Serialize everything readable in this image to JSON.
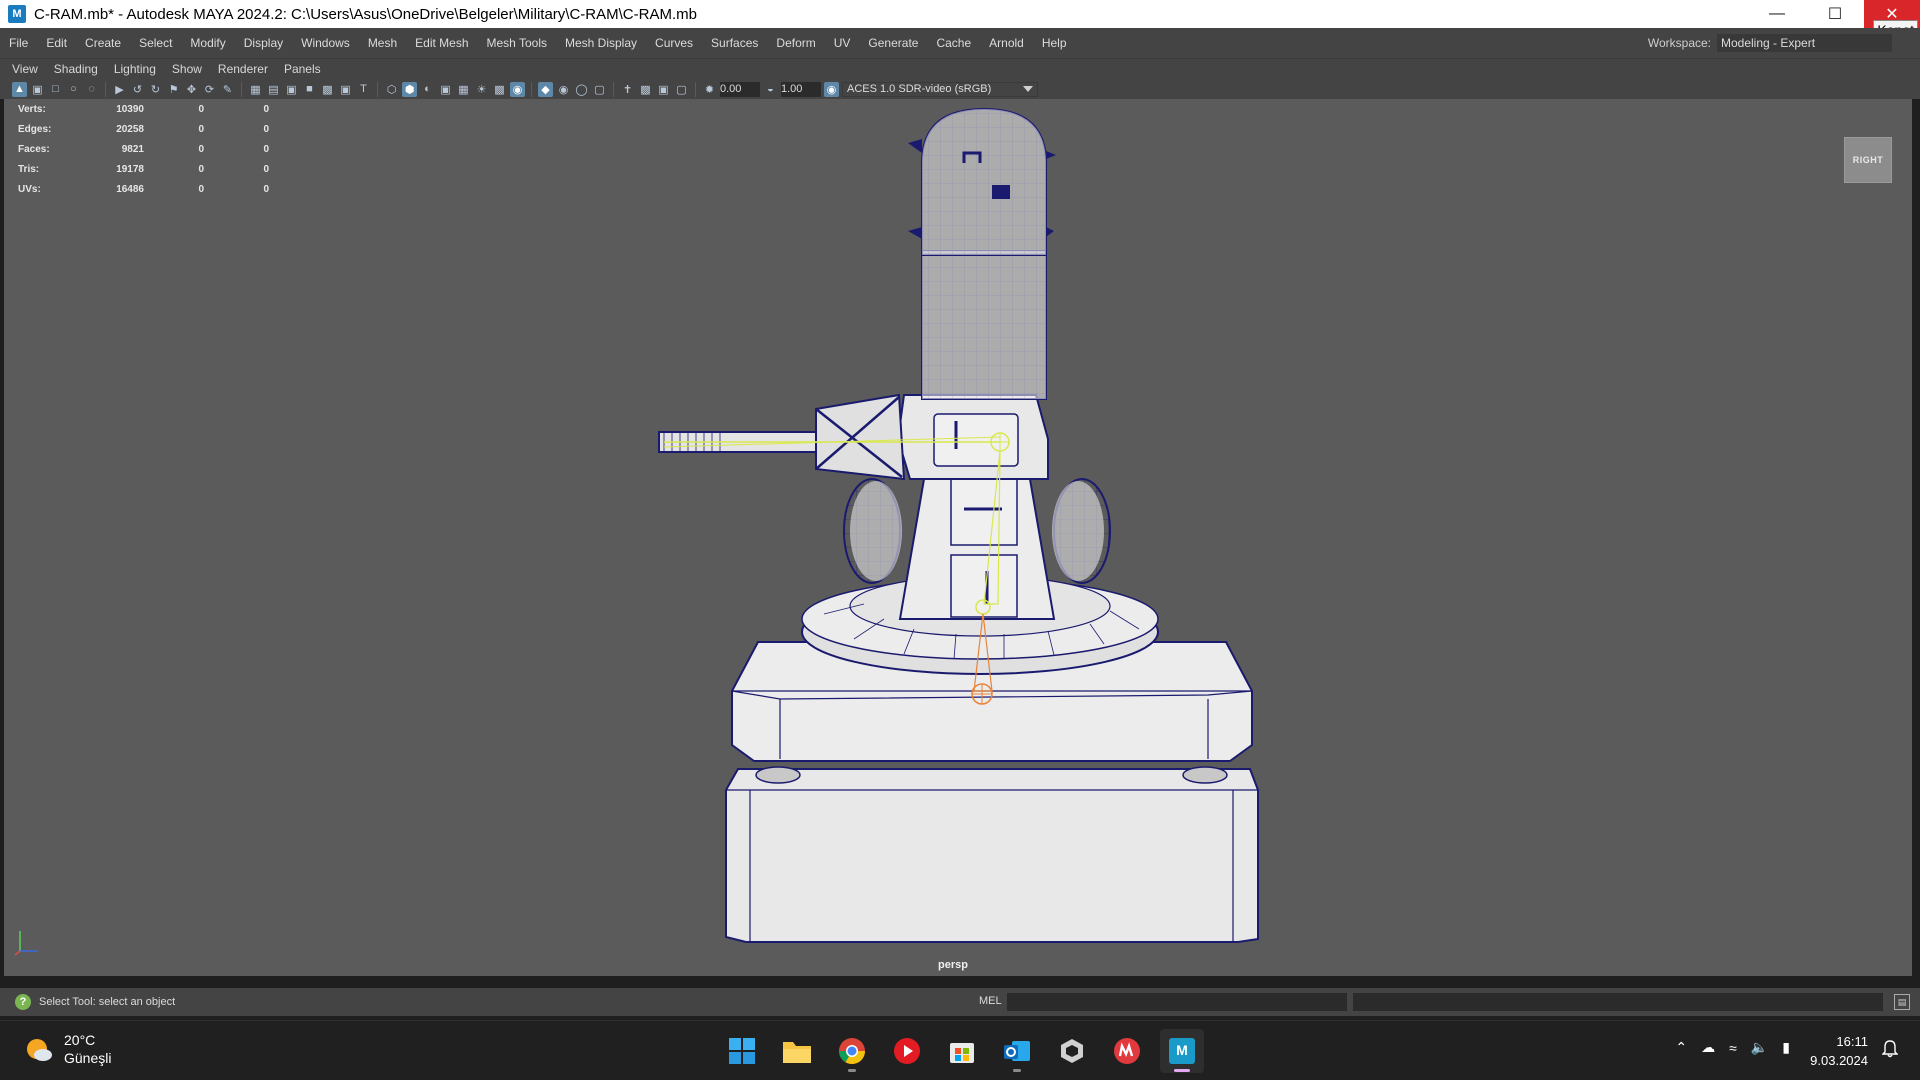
{
  "window": {
    "app_icon": "M",
    "title": "C-RAM.mb* - Autodesk MAYA 2024.2: C:\\Users\\Asus\\OneDrive\\Belgeler\\Military\\C-RAM\\C-RAM.mb",
    "close_tooltip": "Kapat"
  },
  "main_menu": [
    "File",
    "Edit",
    "Create",
    "Select",
    "Modify",
    "Display",
    "Windows",
    "Mesh",
    "Edit Mesh",
    "Mesh Tools",
    "Mesh Display",
    "Curves",
    "Surfaces",
    "Deform",
    "UV",
    "Generate",
    "Cache",
    "Arnold",
    "Help"
  ],
  "workspace": {
    "label": "Workspace:",
    "value": "Modeling - Expert"
  },
  "panel_menu": [
    "View",
    "Shading",
    "Lighting",
    "Show",
    "Renderer",
    "Panels"
  ],
  "panel_toolbar": {
    "exposure": "0.00",
    "gamma": "1.00",
    "color_space": "ACES 1.0 SDR-video (sRGB)"
  },
  "hud": [
    {
      "label": "Verts:",
      "v1": "10390",
      "v2": "0",
      "v3": "0"
    },
    {
      "label": "Edges:",
      "v1": "20258",
      "v2": "0",
      "v3": "0"
    },
    {
      "label": "Faces:",
      "v1": "9821",
      "v2": "0",
      "v3": "0"
    },
    {
      "label": "Tris:",
      "v1": "19178",
      "v2": "0",
      "v3": "0"
    },
    {
      "label": "UVs:",
      "v1": "16486",
      "v2": "0",
      "v3": "0"
    }
  ],
  "viewcube_label": "RIGHT",
  "camera_name": "persp",
  "status": {
    "help_text": "Select Tool: select an object",
    "mel_label": "MEL",
    "command_value": ""
  },
  "taskbar": {
    "temperature": "20°C",
    "condition": "Güneşli",
    "time": "16:11",
    "date": "9.03.2024",
    "apps": [
      "start-icon",
      "file-explorer-icon",
      "chrome-icon",
      "media-player-icon",
      "store-icon",
      "outlook-icon",
      "unity-icon",
      "meetup-icon",
      "maya-icon"
    ]
  },
  "colors": {
    "viewport_bg": "#5b5b5b",
    "wire": "#1a1a6e",
    "surface": "#e6e6e6",
    "joint_yellow": "#d8e84a",
    "joint_orange": "#e8843a"
  }
}
